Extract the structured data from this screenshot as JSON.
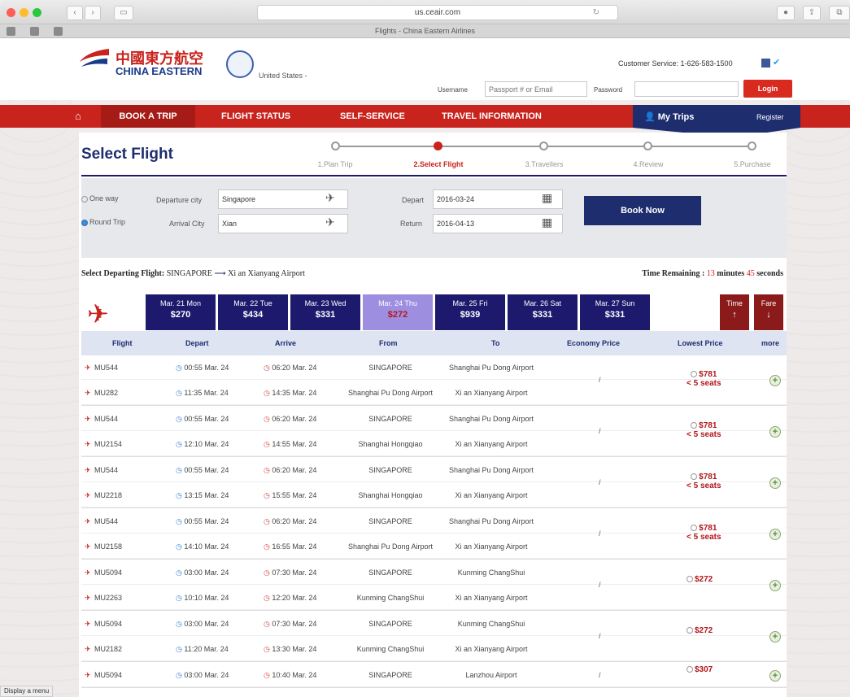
{
  "browser": {
    "url": "us.ceair.com",
    "tab_title": "Flights - China Eastern Airlines",
    "status_bar": "Display a menu"
  },
  "header": {
    "logo_cn": "中國東方航空",
    "logo_en": "CHINA EASTERN",
    "country": "United States -",
    "customer_service": "Customer Service: 1-626-583-1500",
    "username_label": "Username",
    "username_placeholder": "Passport # or Email",
    "password_label": "Password",
    "login": "Login"
  },
  "nav": {
    "items": [
      "BOOK A TRIP",
      "FLIGHT STATUS",
      "SELF-SERVICE",
      "TRAVEL INFORMATION"
    ],
    "my_trips": "My Trips",
    "register": "Register"
  },
  "page_title": "Select Flight",
  "steps": [
    "1.Plan Trip",
    "2.Select Flight",
    "3.Travellers",
    "4.Review",
    "5.Purchase"
  ],
  "search": {
    "one_way": "One way",
    "round_trip": "Round Trip",
    "departure_city_label": "Departure city",
    "departure_city": "Singapore",
    "arrival_city_label": "Arrival City",
    "arrival_city": "Xian",
    "depart_label": "Depart",
    "depart_date": "2016-03-24",
    "return_label": "Return",
    "return_date": "2016-04-13",
    "book_now": "Book Now"
  },
  "route": {
    "label": "Select Departing Flight:",
    "from": "SINGAPORE",
    "to": "Xi an Xianyang Airport",
    "time_label": "Time Remaining :",
    "minutes": "13",
    "minutes_label": "minutes",
    "seconds": "45",
    "seconds_label": "seconds"
  },
  "dates": [
    {
      "day": "Mar. 21 Mon",
      "price": "$270"
    },
    {
      "day": "Mar. 22 Tue",
      "price": "$434"
    },
    {
      "day": "Mar. 23 Wed",
      "price": "$331"
    },
    {
      "day": "Mar. 24 Thu",
      "price": "$272"
    },
    {
      "day": "Mar. 25 Fri",
      "price": "$939"
    },
    {
      "day": "Mar. 26 Sat",
      "price": "$331"
    },
    {
      "day": "Mar. 27 Sun",
      "price": "$331"
    }
  ],
  "sort": {
    "time": "Time",
    "time_arrow": "↑",
    "fare": "Fare",
    "fare_arrow": "↓"
  },
  "columns": [
    "Flight",
    "Depart",
    "Arrive",
    "From",
    "To",
    "Economy Price",
    "Lowest Price",
    "more"
  ],
  "groups": [
    {
      "economy": "/",
      "lowest": "$781",
      "seats": "< 5 seats",
      "legs": [
        {
          "flight": "MU544",
          "depart": "00:55 Mar. 24",
          "arrive": "06:20 Mar. 24",
          "from": "SINGAPORE",
          "to": "Shanghai Pu Dong Airport"
        },
        {
          "flight": "MU282",
          "depart": "11:35 Mar. 24",
          "arrive": "14:35 Mar. 24",
          "from": "Shanghai Pu Dong Airport",
          "to": "Xi an Xianyang Airport"
        }
      ]
    },
    {
      "economy": "/",
      "lowest": "$781",
      "seats": "< 5 seats",
      "legs": [
        {
          "flight": "MU544",
          "depart": "00:55 Mar. 24",
          "arrive": "06:20 Mar. 24",
          "from": "SINGAPORE",
          "to": "Shanghai Pu Dong Airport"
        },
        {
          "flight": "MU2154",
          "depart": "12:10 Mar. 24",
          "arrive": "14:55 Mar. 24",
          "from": "Shanghai Hongqiao",
          "to": "Xi an Xianyang Airport"
        }
      ]
    },
    {
      "economy": "/",
      "lowest": "$781",
      "seats": "< 5 seats",
      "legs": [
        {
          "flight": "MU544",
          "depart": "00:55 Mar. 24",
          "arrive": "06:20 Mar. 24",
          "from": "SINGAPORE",
          "to": "Shanghai Pu Dong Airport"
        },
        {
          "flight": "MU2218",
          "depart": "13:15 Mar. 24",
          "arrive": "15:55 Mar. 24",
          "from": "Shanghai Hongqiao",
          "to": "Xi an Xianyang Airport"
        }
      ]
    },
    {
      "economy": "/",
      "lowest": "$781",
      "seats": "< 5 seats",
      "legs": [
        {
          "flight": "MU544",
          "depart": "00:55 Mar. 24",
          "arrive": "06:20 Mar. 24",
          "from": "SINGAPORE",
          "to": "Shanghai Pu Dong Airport"
        },
        {
          "flight": "MU2158",
          "depart": "14:10 Mar. 24",
          "arrive": "16:55 Mar. 24",
          "from": "Shanghai Pu Dong Airport",
          "to": "Xi an Xianyang Airport"
        }
      ]
    },
    {
      "economy": "/",
      "lowest": "$272",
      "seats": "",
      "legs": [
        {
          "flight": "MU5094",
          "depart": "03:00 Mar. 24",
          "arrive": "07:30 Mar. 24",
          "from": "SINGAPORE",
          "to": "Kunming ChangShui"
        },
        {
          "flight": "MU2263",
          "depart": "10:10 Mar. 24",
          "arrive": "12:20 Mar. 24",
          "from": "Kunming ChangShui",
          "to": "Xi an Xianyang Airport"
        }
      ]
    },
    {
      "economy": "/",
      "lowest": "$272",
      "seats": "",
      "legs": [
        {
          "flight": "MU5094",
          "depart": "03:00 Mar. 24",
          "arrive": "07:30 Mar. 24",
          "from": "SINGAPORE",
          "to": "Kunming ChangShui"
        },
        {
          "flight": "MU2182",
          "depart": "11:20 Mar. 24",
          "arrive": "13:30 Mar. 24",
          "from": "Kunming ChangShui",
          "to": "Xi an Xianyang Airport"
        }
      ]
    },
    {
      "economy": "/",
      "lowest": "$307",
      "seats": "",
      "legs": [
        {
          "flight": "MU5094",
          "depart": "03:00 Mar. 24",
          "arrive": "10:40 Mar. 24",
          "from": "SINGAPORE",
          "to": "Lanzhou Airport"
        }
      ]
    }
  ],
  "colors": {
    "brand_red": "#c8231c",
    "navy": "#1d1a6e",
    "selected_date": "#9d8ee0",
    "sort_red": "#8b1a1a",
    "price_red": "#b3161b"
  }
}
